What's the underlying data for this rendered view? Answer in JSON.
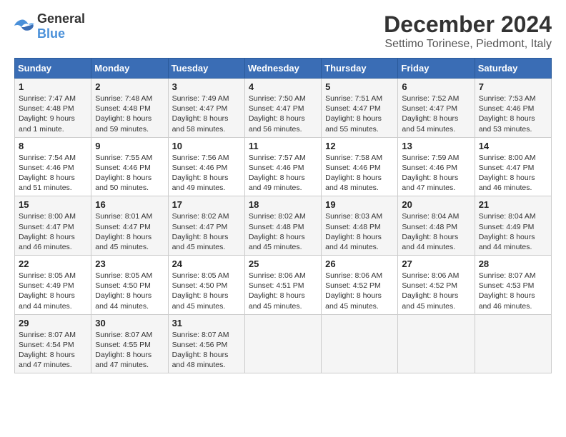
{
  "logo": {
    "general": "General",
    "blue": "Blue"
  },
  "title": "December 2024",
  "subtitle": "Settimo Torinese, Piedmont, Italy",
  "header_days": [
    "Sunday",
    "Monday",
    "Tuesday",
    "Wednesday",
    "Thursday",
    "Friday",
    "Saturday"
  ],
  "weeks": [
    [
      {
        "day": "1",
        "sunrise": "Sunrise: 7:47 AM",
        "sunset": "Sunset: 4:48 PM",
        "daylight": "Daylight: 9 hours and 1 minute."
      },
      {
        "day": "2",
        "sunrise": "Sunrise: 7:48 AM",
        "sunset": "Sunset: 4:48 PM",
        "daylight": "Daylight: 8 hours and 59 minutes."
      },
      {
        "day": "3",
        "sunrise": "Sunrise: 7:49 AM",
        "sunset": "Sunset: 4:47 PM",
        "daylight": "Daylight: 8 hours and 58 minutes."
      },
      {
        "day": "4",
        "sunrise": "Sunrise: 7:50 AM",
        "sunset": "Sunset: 4:47 PM",
        "daylight": "Daylight: 8 hours and 56 minutes."
      },
      {
        "day": "5",
        "sunrise": "Sunrise: 7:51 AM",
        "sunset": "Sunset: 4:47 PM",
        "daylight": "Daylight: 8 hours and 55 minutes."
      },
      {
        "day": "6",
        "sunrise": "Sunrise: 7:52 AM",
        "sunset": "Sunset: 4:47 PM",
        "daylight": "Daylight: 8 hours and 54 minutes."
      },
      {
        "day": "7",
        "sunrise": "Sunrise: 7:53 AM",
        "sunset": "Sunset: 4:46 PM",
        "daylight": "Daylight: 8 hours and 53 minutes."
      }
    ],
    [
      {
        "day": "8",
        "sunrise": "Sunrise: 7:54 AM",
        "sunset": "Sunset: 4:46 PM",
        "daylight": "Daylight: 8 hours and 51 minutes."
      },
      {
        "day": "9",
        "sunrise": "Sunrise: 7:55 AM",
        "sunset": "Sunset: 4:46 PM",
        "daylight": "Daylight: 8 hours and 50 minutes."
      },
      {
        "day": "10",
        "sunrise": "Sunrise: 7:56 AM",
        "sunset": "Sunset: 4:46 PM",
        "daylight": "Daylight: 8 hours and 49 minutes."
      },
      {
        "day": "11",
        "sunrise": "Sunrise: 7:57 AM",
        "sunset": "Sunset: 4:46 PM",
        "daylight": "Daylight: 8 hours and 49 minutes."
      },
      {
        "day": "12",
        "sunrise": "Sunrise: 7:58 AM",
        "sunset": "Sunset: 4:46 PM",
        "daylight": "Daylight: 8 hours and 48 minutes."
      },
      {
        "day": "13",
        "sunrise": "Sunrise: 7:59 AM",
        "sunset": "Sunset: 4:46 PM",
        "daylight": "Daylight: 8 hours and 47 minutes."
      },
      {
        "day": "14",
        "sunrise": "Sunrise: 8:00 AM",
        "sunset": "Sunset: 4:47 PM",
        "daylight": "Daylight: 8 hours and 46 minutes."
      }
    ],
    [
      {
        "day": "15",
        "sunrise": "Sunrise: 8:00 AM",
        "sunset": "Sunset: 4:47 PM",
        "daylight": "Daylight: 8 hours and 46 minutes."
      },
      {
        "day": "16",
        "sunrise": "Sunrise: 8:01 AM",
        "sunset": "Sunset: 4:47 PM",
        "daylight": "Daylight: 8 hours and 45 minutes."
      },
      {
        "day": "17",
        "sunrise": "Sunrise: 8:02 AM",
        "sunset": "Sunset: 4:47 PM",
        "daylight": "Daylight: 8 hours and 45 minutes."
      },
      {
        "day": "18",
        "sunrise": "Sunrise: 8:02 AM",
        "sunset": "Sunset: 4:48 PM",
        "daylight": "Daylight: 8 hours and 45 minutes."
      },
      {
        "day": "19",
        "sunrise": "Sunrise: 8:03 AM",
        "sunset": "Sunset: 4:48 PM",
        "daylight": "Daylight: 8 hours and 44 minutes."
      },
      {
        "day": "20",
        "sunrise": "Sunrise: 8:04 AM",
        "sunset": "Sunset: 4:48 PM",
        "daylight": "Daylight: 8 hours and 44 minutes."
      },
      {
        "day": "21",
        "sunrise": "Sunrise: 8:04 AM",
        "sunset": "Sunset: 4:49 PM",
        "daylight": "Daylight: 8 hours and 44 minutes."
      }
    ],
    [
      {
        "day": "22",
        "sunrise": "Sunrise: 8:05 AM",
        "sunset": "Sunset: 4:49 PM",
        "daylight": "Daylight: 8 hours and 44 minutes."
      },
      {
        "day": "23",
        "sunrise": "Sunrise: 8:05 AM",
        "sunset": "Sunset: 4:50 PM",
        "daylight": "Daylight: 8 hours and 44 minutes."
      },
      {
        "day": "24",
        "sunrise": "Sunrise: 8:05 AM",
        "sunset": "Sunset: 4:50 PM",
        "daylight": "Daylight: 8 hours and 45 minutes."
      },
      {
        "day": "25",
        "sunrise": "Sunrise: 8:06 AM",
        "sunset": "Sunset: 4:51 PM",
        "daylight": "Daylight: 8 hours and 45 minutes."
      },
      {
        "day": "26",
        "sunrise": "Sunrise: 8:06 AM",
        "sunset": "Sunset: 4:52 PM",
        "daylight": "Daylight: 8 hours and 45 minutes."
      },
      {
        "day": "27",
        "sunrise": "Sunrise: 8:06 AM",
        "sunset": "Sunset: 4:52 PM",
        "daylight": "Daylight: 8 hours and 45 minutes."
      },
      {
        "day": "28",
        "sunrise": "Sunrise: 8:07 AM",
        "sunset": "Sunset: 4:53 PM",
        "daylight": "Daylight: 8 hours and 46 minutes."
      }
    ],
    [
      {
        "day": "29",
        "sunrise": "Sunrise: 8:07 AM",
        "sunset": "Sunset: 4:54 PM",
        "daylight": "Daylight: 8 hours and 47 minutes."
      },
      {
        "day": "30",
        "sunrise": "Sunrise: 8:07 AM",
        "sunset": "Sunset: 4:55 PM",
        "daylight": "Daylight: 8 hours and 47 minutes."
      },
      {
        "day": "31",
        "sunrise": "Sunrise: 8:07 AM",
        "sunset": "Sunset: 4:56 PM",
        "daylight": "Daylight: 8 hours and 48 minutes."
      },
      null,
      null,
      null,
      null
    ]
  ]
}
